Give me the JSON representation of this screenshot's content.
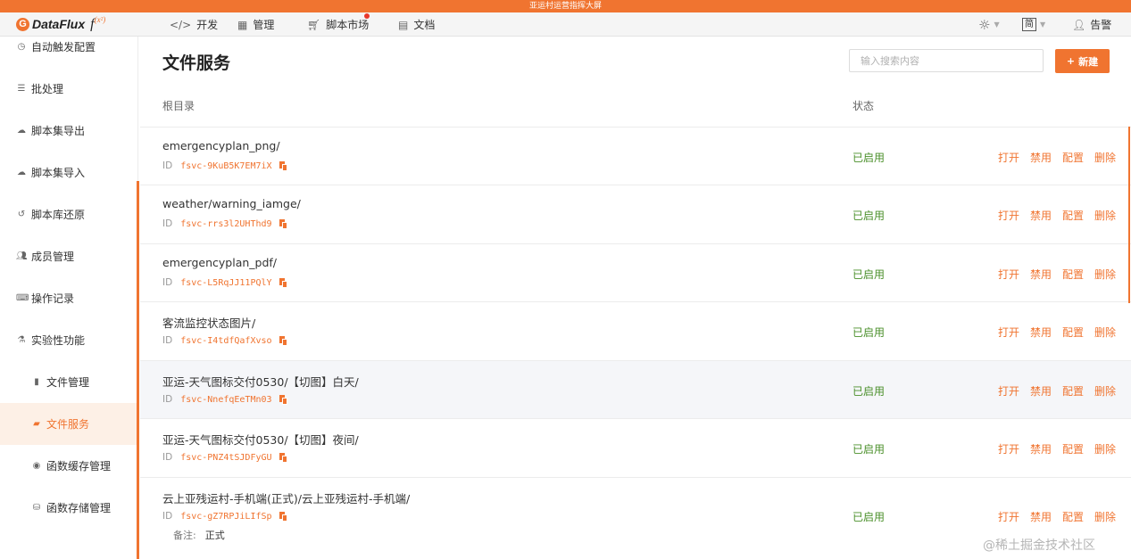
{
  "banner": {
    "text": "亚运村运营指挥大屏"
  },
  "app": {
    "logo_mark": "G",
    "name": "DataFlux",
    "fx": "f",
    "fx_sup": "(x²)"
  },
  "topnav": [
    {
      "label": "开发",
      "icon": "code-icon"
    },
    {
      "label": "管理",
      "icon": "grid-icon"
    },
    {
      "label": "脚本市场",
      "icon": "cart-icon"
    },
    {
      "label": "文档",
      "icon": "book-icon"
    }
  ],
  "topright": {
    "lang": "简",
    "user": "告警"
  },
  "sidebar": [
    {
      "label": "自动触发配置",
      "icon": "clock-icon"
    },
    {
      "label": "批处理",
      "icon": "list-icon"
    },
    {
      "label": "脚本集导出",
      "icon": "cloud-download-icon"
    },
    {
      "label": "脚本集导入",
      "icon": "cloud-upload-icon"
    },
    {
      "label": "脚本库还原",
      "icon": "history-icon"
    },
    {
      "label": "成员管理",
      "icon": "users-icon"
    },
    {
      "label": "操作记录",
      "icon": "keyboard-icon"
    },
    {
      "label": "实验性功能",
      "icon": "flask-icon"
    },
    {
      "label": "文件管理",
      "icon": "file-icon"
    },
    {
      "label": "文件服务",
      "icon": "folder-open-icon"
    },
    {
      "label": "函数缓存管理",
      "icon": "target-icon"
    },
    {
      "label": "函数存储管理",
      "icon": "database-icon"
    }
  ],
  "main": {
    "title": "文件服务",
    "search_placeholder": "输入搜索内容",
    "new_button": "新建",
    "columns": {
      "root": "根目录",
      "status": "状态"
    },
    "id_label": "ID",
    "note_label": "备注:",
    "actions": [
      "打开",
      "禁用",
      "配置",
      "删除"
    ],
    "rows": [
      {
        "path": "emergencyplan_png/",
        "id": "fsvc-9KuB5K7EM7iX",
        "status": "已启用"
      },
      {
        "path": "weather/warning_iamge/",
        "id": "fsvc-rrs3l2UHThd9",
        "status": "已启用"
      },
      {
        "path": "emergencyplan_pdf/",
        "id": "fsvc-L5RqJJ11PQlY",
        "status": "已启用"
      },
      {
        "path": "客流监控状态图片/",
        "id": "fsvc-I4tdfQafXvso",
        "status": "已启用"
      },
      {
        "path": "亚运-天气图标交付0530/【切图】白天/",
        "id": "fsvc-NnefqEeTMn03",
        "status": "已启用"
      },
      {
        "path": "亚运-天气图标交付0530/【切图】夜间/",
        "id": "fsvc-PNZ4tSJDFyGU",
        "status": "已启用"
      },
      {
        "path": "云上亚残运村-手机端(正式)/云上亚残运村-手机端/",
        "id": "fsvc-gZ7RPJiLIfSp",
        "status": "已启用",
        "note": "正式"
      }
    ]
  },
  "watermark": "@稀土掘金技术社区",
  "colors": {
    "accent": "#f07430",
    "enabled": "#4a8f2a",
    "active_bg": "#fdf0e6"
  }
}
